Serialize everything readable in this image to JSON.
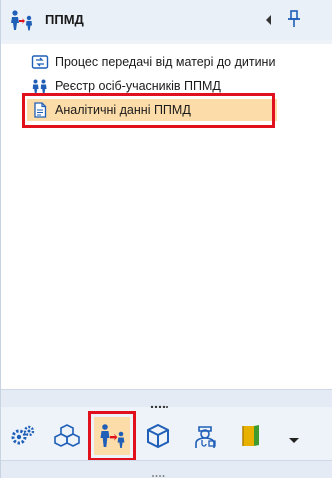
{
  "header": {
    "title": "ППМД",
    "icon": "parent-child-icon"
  },
  "tree": {
    "items": [
      {
        "label": "Процес передачі від матері до дитини",
        "icon": "transfer-process-icon",
        "selected": false
      },
      {
        "label": "Реєстр осіб-учасників ППМД",
        "icon": "people-registry-icon",
        "selected": false
      },
      {
        "label": "Аналітичні данні ППМД",
        "icon": "document-icon",
        "selected": true
      }
    ]
  },
  "toolbar": {
    "items": [
      {
        "icon": "gears-icon",
        "active": false
      },
      {
        "icon": "cubes-icon",
        "active": false
      },
      {
        "icon": "parent-child-icon",
        "active": true
      },
      {
        "icon": "box-icon",
        "active": false
      },
      {
        "icon": "doctor-icon",
        "active": false
      },
      {
        "icon": "book-icon",
        "active": false
      },
      {
        "icon": "dropdown-arrow-icon",
        "active": false
      }
    ]
  },
  "colors": {
    "selection": "#fcdca8",
    "highlight_outline": "#e0101c",
    "panel_background": "#eef3fa",
    "accent_blue": "#1f5fb8"
  }
}
